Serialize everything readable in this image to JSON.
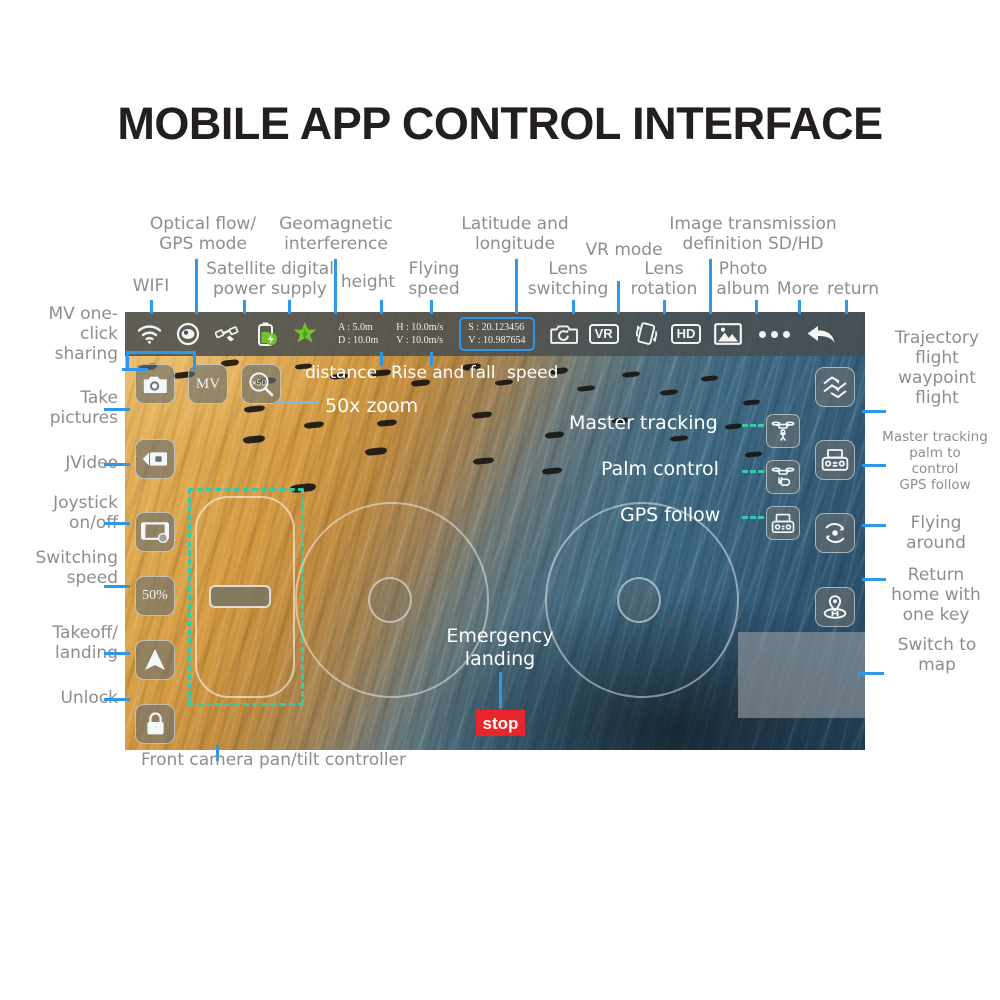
{
  "page": {
    "title": "MOBILE APP CONTROL INTERFACE"
  },
  "colors": {
    "leader_blue": "#2f97e8",
    "leader_teal": "#36ccab",
    "label_gray": "#8d8d8d",
    "stop_red": "#e8252a",
    "title_black": "#231f20",
    "toolbar_gray": "#484e50"
  },
  "toolbar": {
    "icons": [
      {
        "name": "wifi-icon",
        "label": "WIFI"
      },
      {
        "name": "optical-flow-gps-icon",
        "label": "Optical flow/ GPS mode"
      },
      {
        "name": "satellite-icon",
        "label": "Satellite digital power supply"
      },
      {
        "name": "battery-icon",
        "label": "battery"
      },
      {
        "name": "geomagnetic-icon",
        "label": "Geomagnetic interference"
      }
    ],
    "readouts": [
      {
        "name": "altitude",
        "line1": "A : 5.0m",
        "line2": "D : 10.0m"
      },
      {
        "name": "speed",
        "line1": "H : 10.0m/s",
        "line2": "V : 10.0m/s"
      }
    ],
    "gps": {
      "line1": "S : 20.123456",
      "line2": "V : 10.987654"
    },
    "right_icons": [
      {
        "name": "lens-switching-icon",
        "label": "Lens switching"
      },
      {
        "name": "vr-mode-icon",
        "label": "VR"
      },
      {
        "name": "lens-rotation-icon",
        "label": "Lens rotation"
      },
      {
        "name": "hd-icon",
        "label": "HD"
      },
      {
        "name": "photo-album-icon",
        "label": "Photo album"
      },
      {
        "name": "more-icon",
        "label": "More"
      },
      {
        "name": "return-icon",
        "label": "return"
      }
    ]
  },
  "top_callouts": [
    {
      "name": "wifi",
      "text": "WIFI"
    },
    {
      "name": "optical-flow-gps-mode",
      "line1": "Optical flow/",
      "line2": "GPS mode"
    },
    {
      "name": "satellite-digital-power-supply",
      "line1": "Satellite digital",
      "line2": "power supply"
    },
    {
      "name": "geomagnetic-interference",
      "line1": "Geomagnetic",
      "line2": "interference"
    },
    {
      "name": "height",
      "text": "height"
    },
    {
      "name": "flying-speed",
      "line1": "Flying",
      "line2": "speed"
    },
    {
      "name": "latitude-and-longitude",
      "line1": "Latitude and",
      "line2": "longitude"
    },
    {
      "name": "lens-switching",
      "line1": "Lens",
      "line2": "switching"
    },
    {
      "name": "vr-mode",
      "text": "VR mode"
    },
    {
      "name": "lens-rotation",
      "line1": "Lens",
      "line2": "rotation"
    },
    {
      "name": "image-transmission-definition",
      "line1": "Image transmission",
      "line2": "definition SD/HD"
    },
    {
      "name": "photo-album",
      "line1": "Photo",
      "line2": "album"
    },
    {
      "name": "more",
      "text": "More"
    },
    {
      "name": "return",
      "text": "return"
    }
  ],
  "left_callouts": [
    {
      "name": "mv-one-click-sharing",
      "lines": [
        "MV one-",
        "click",
        "sharing"
      ]
    },
    {
      "name": "take-pictures",
      "lines": [
        "Take",
        "pictures"
      ]
    },
    {
      "name": "jvideo",
      "lines": [
        "JVideo"
      ]
    },
    {
      "name": "joystick-on-off",
      "lines": [
        "Joystick",
        "on/off"
      ]
    },
    {
      "name": "switching-speed",
      "lines": [
        "Switching",
        "speed"
      ]
    },
    {
      "name": "takeoff-landing",
      "lines": [
        "Takeoff/",
        "landing"
      ]
    },
    {
      "name": "unlock",
      "lines": [
        "Unlock"
      ]
    }
  ],
  "right_callouts": [
    {
      "name": "trajectory-flight-waypoint-flight",
      "lines": [
        "Trajectory",
        "flight",
        "waypoint",
        "flight"
      ]
    },
    {
      "name": "master-tracking-palm-gps",
      "lines": [
        "Master tracking",
        "palm to",
        "control",
        "GPS follow"
      ]
    },
    {
      "name": "flying-around",
      "lines": [
        "Flying",
        "around"
      ]
    },
    {
      "name": "return-home-with-one-key",
      "lines": [
        "Return",
        "home with",
        "one key"
      ]
    },
    {
      "name": "switch-to-map",
      "lines": [
        "Switch to",
        "map"
      ]
    }
  ],
  "photo_labels": {
    "distance": "distance",
    "rise_and_fall": "Rise and fall",
    "speed": "speed",
    "zoom": "50x zoom",
    "master_tracking": "Master tracking",
    "palm_control": "Palm control",
    "gps_follow": "GPS follow",
    "emergency_line1": "Emergency",
    "emergency_line2": "landing"
  },
  "bottom_callout": {
    "name": "front-camera-pan-tilt-controller",
    "text": "Front camera pan/tilt controller"
  },
  "app_controls": {
    "left": [
      {
        "name": "take-picture-button",
        "icon": "camera-icon"
      },
      {
        "name": "mv-button",
        "icon": "mv-text",
        "label": "MV"
      },
      {
        "name": "zoom-50x-button",
        "icon": "magnifier-50-icon",
        "label": "50"
      },
      {
        "name": "video-button",
        "icon": "video-camera-icon"
      },
      {
        "name": "joystick-toggle-button",
        "icon": "joystick-panel-icon"
      },
      {
        "name": "speed-switch-button",
        "icon": "percent-text",
        "label": "50%"
      },
      {
        "name": "takeoff-landing-button",
        "icon": "takeoff-arrow-icon"
      },
      {
        "name": "unlock-button",
        "icon": "lock-icon"
      }
    ],
    "center_right": [
      {
        "name": "master-tracking-button",
        "icon": "drone-follow-person-icon"
      },
      {
        "name": "palm-control-button",
        "icon": "drone-palm-icon"
      },
      {
        "name": "gps-follow-button",
        "icon": "remote-controller-icon"
      }
    ],
    "right": [
      {
        "name": "waypoint-flight-button",
        "icon": "waypoint-path-icon"
      },
      {
        "name": "master-tracking-panel-button",
        "icon": "remote-controller-icon"
      },
      {
        "name": "flying-around-button",
        "icon": "orbit-icon"
      },
      {
        "name": "return-home-button",
        "icon": "home-pin-icon"
      }
    ],
    "emergency": {
      "name": "emergency-stop-button",
      "label": "stop"
    }
  }
}
